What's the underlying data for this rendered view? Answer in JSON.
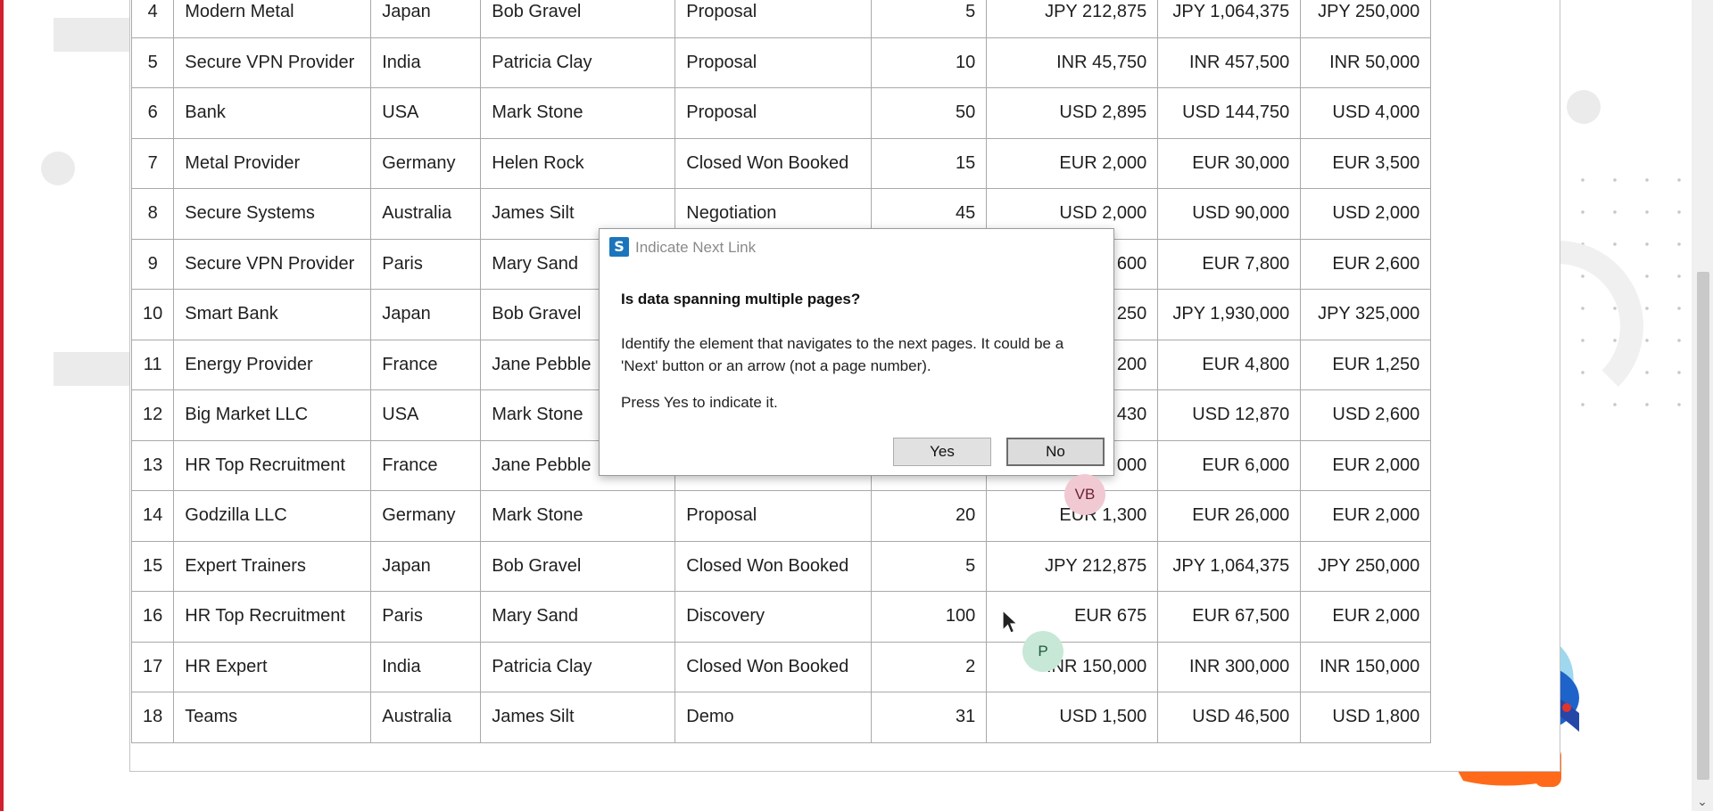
{
  "table": {
    "rows": [
      [
        "4",
        "Modern Metal",
        "Japan",
        "Bob Gravel",
        "Proposal",
        "5",
        "JPY 212,875",
        "JPY 1,064,375",
        "JPY 250,000"
      ],
      [
        "5",
        "Secure VPN Provider",
        "India",
        "Patricia Clay",
        "Proposal",
        "10",
        "INR 45,750",
        "INR 457,500",
        "INR 50,000"
      ],
      [
        "6",
        "Bank",
        "USA",
        "Mark Stone",
        "Proposal",
        "50",
        "USD 2,895",
        "USD 144,750",
        "USD 4,000"
      ],
      [
        "7",
        "Metal Provider",
        "Germany",
        "Helen Rock",
        "Closed Won Booked",
        "15",
        "EUR 2,000",
        "EUR 30,000",
        "EUR 3,500"
      ],
      [
        "8",
        "Secure Systems",
        "Australia",
        "James Silt",
        "Negotiation",
        "45",
        "USD 2,000",
        "USD 90,000",
        "USD 2,000"
      ],
      [
        "9",
        "Secure VPN Provider",
        "Paris",
        "Mary Sand",
        "",
        "",
        "600",
        "EUR 7,800",
        "EUR 2,600"
      ],
      [
        "10",
        "Smart Bank",
        "Japan",
        "Bob Gravel",
        "",
        "",
        "250",
        "JPY 1,930,000",
        "JPY 325,000"
      ],
      [
        "11",
        "Energy Provider",
        "France",
        "Jane Pebble",
        "",
        "",
        "200",
        "EUR 4,800",
        "EUR 1,250"
      ],
      [
        "12",
        "Big Market LLC",
        "USA",
        "Mark Stone",
        "",
        "",
        "430",
        "USD 12,870",
        "USD 2,600"
      ],
      [
        "13",
        "HR Top Recruitment",
        "France",
        "Jane Pebble",
        "",
        "",
        "000",
        "EUR 6,000",
        "EUR 2,000"
      ],
      [
        "14",
        "Godzilla LLC",
        "Germany",
        "Mark Stone",
        "Proposal",
        "20",
        "EUR 1,300",
        "EUR 26,000",
        "EUR 2,000"
      ],
      [
        "15",
        "Expert Trainers",
        "Japan",
        "Bob Gravel",
        "Closed Won Booked",
        "5",
        "JPY 212,875",
        "JPY 1,064,375",
        "JPY 250,000"
      ],
      [
        "16",
        "HR Top Recruitment",
        "Paris",
        "Mary Sand",
        "Discovery",
        "100",
        "EUR 675",
        "EUR 67,500",
        "EUR 2,000"
      ],
      [
        "17",
        "HR Expert",
        "India",
        "Patricia Clay",
        "Closed Won Booked",
        "2",
        "INR 150,000",
        "INR 300,000",
        "INR 150,000"
      ],
      [
        "18",
        "Teams",
        "Australia",
        "James Silt",
        "Demo",
        "31",
        "USD 1,500",
        "USD 46,500",
        "USD 1,800"
      ]
    ]
  },
  "dialog": {
    "title": "Indicate Next Link",
    "icon": "app-logo-icon",
    "question": "Is data spanning multiple pages?",
    "message": "Identify the element that navigates to the next pages. It could be a 'Next' button or an arrow (not a page number).",
    "prompt": "Press Yes to indicate it.",
    "yes_label": "Yes",
    "no_label": "No"
  },
  "avatars": [
    {
      "initials": "VB",
      "color": "#f1c9d3"
    },
    {
      "initials": "P",
      "color": "#c7e8d6"
    }
  ],
  "colors": {
    "accent_red": "#d1202f",
    "dialog_icon": "#1b75bc"
  }
}
